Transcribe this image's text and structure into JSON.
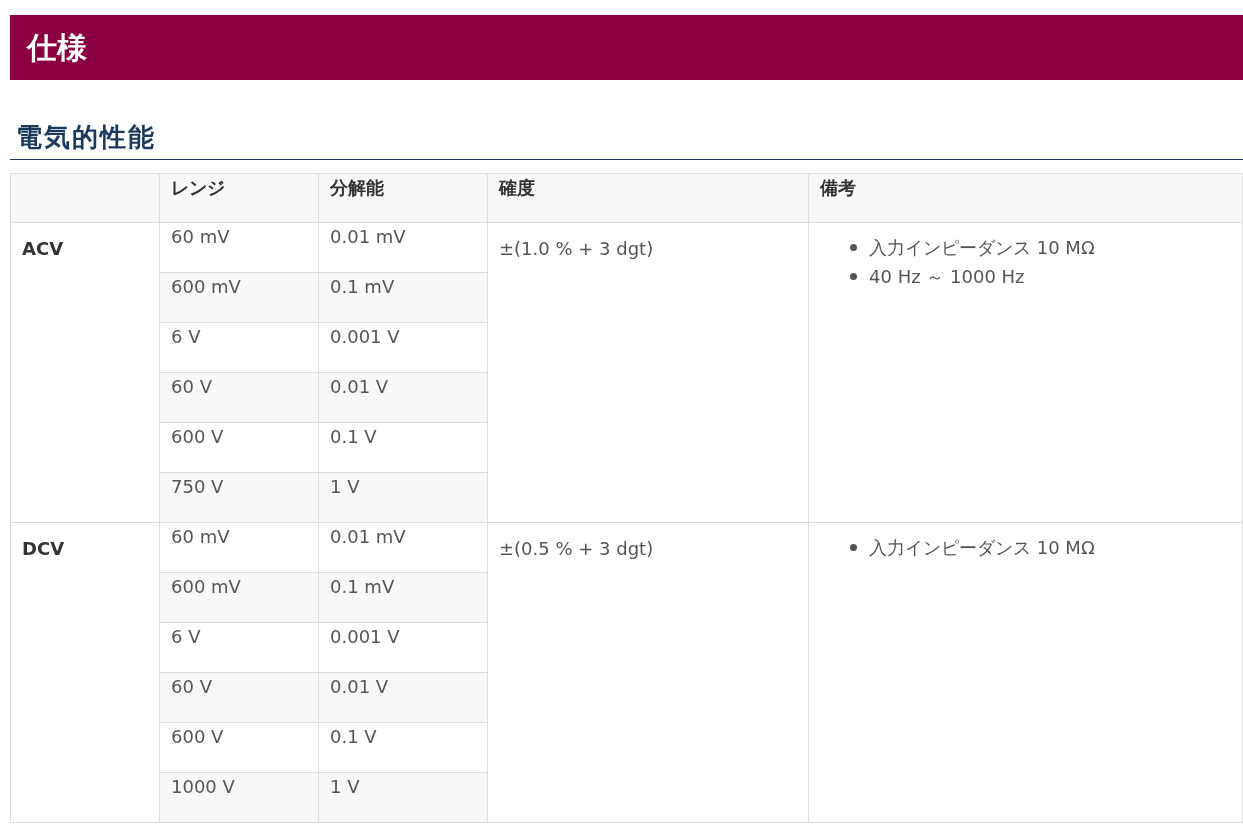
{
  "page_title": "仕様",
  "section_title": "電気的性能",
  "table": {
    "columns": [
      "レンジ",
      "分解能",
      "確度",
      "備考"
    ],
    "groups": [
      {
        "function": "ACV",
        "accuracy": "±(1.0 % + 3 dgt)",
        "notes": [
          "入力インピーダンス 10 MΩ",
          "40 Hz ～ 1000 Hz"
        ],
        "ranges": [
          {
            "range": "60 mV",
            "resolution": "0.01 mV"
          },
          {
            "range": "600 mV",
            "resolution": "0.1 mV"
          },
          {
            "range": "6 V",
            "resolution": "0.001 V"
          },
          {
            "range": "60 V",
            "resolution": "0.01 V"
          },
          {
            "range": "600 V",
            "resolution": "0.1 V"
          },
          {
            "range": "750 V",
            "resolution": "1 V"
          }
        ]
      },
      {
        "function": "DCV",
        "accuracy": "±(0.5 % + 3 dgt)",
        "notes": [
          "入力インピーダンス 10 MΩ"
        ],
        "ranges": [
          {
            "range": "60 mV",
            "resolution": "0.01 mV"
          },
          {
            "range": "600 mV",
            "resolution": "0.1 mV"
          },
          {
            "range": "6 V",
            "resolution": "0.001 V"
          },
          {
            "range": "60 V",
            "resolution": "0.01 V"
          },
          {
            "range": "600 V",
            "resolution": "0.1 V"
          },
          {
            "range": "1000 V",
            "resolution": "1 V"
          }
        ]
      }
    ]
  }
}
